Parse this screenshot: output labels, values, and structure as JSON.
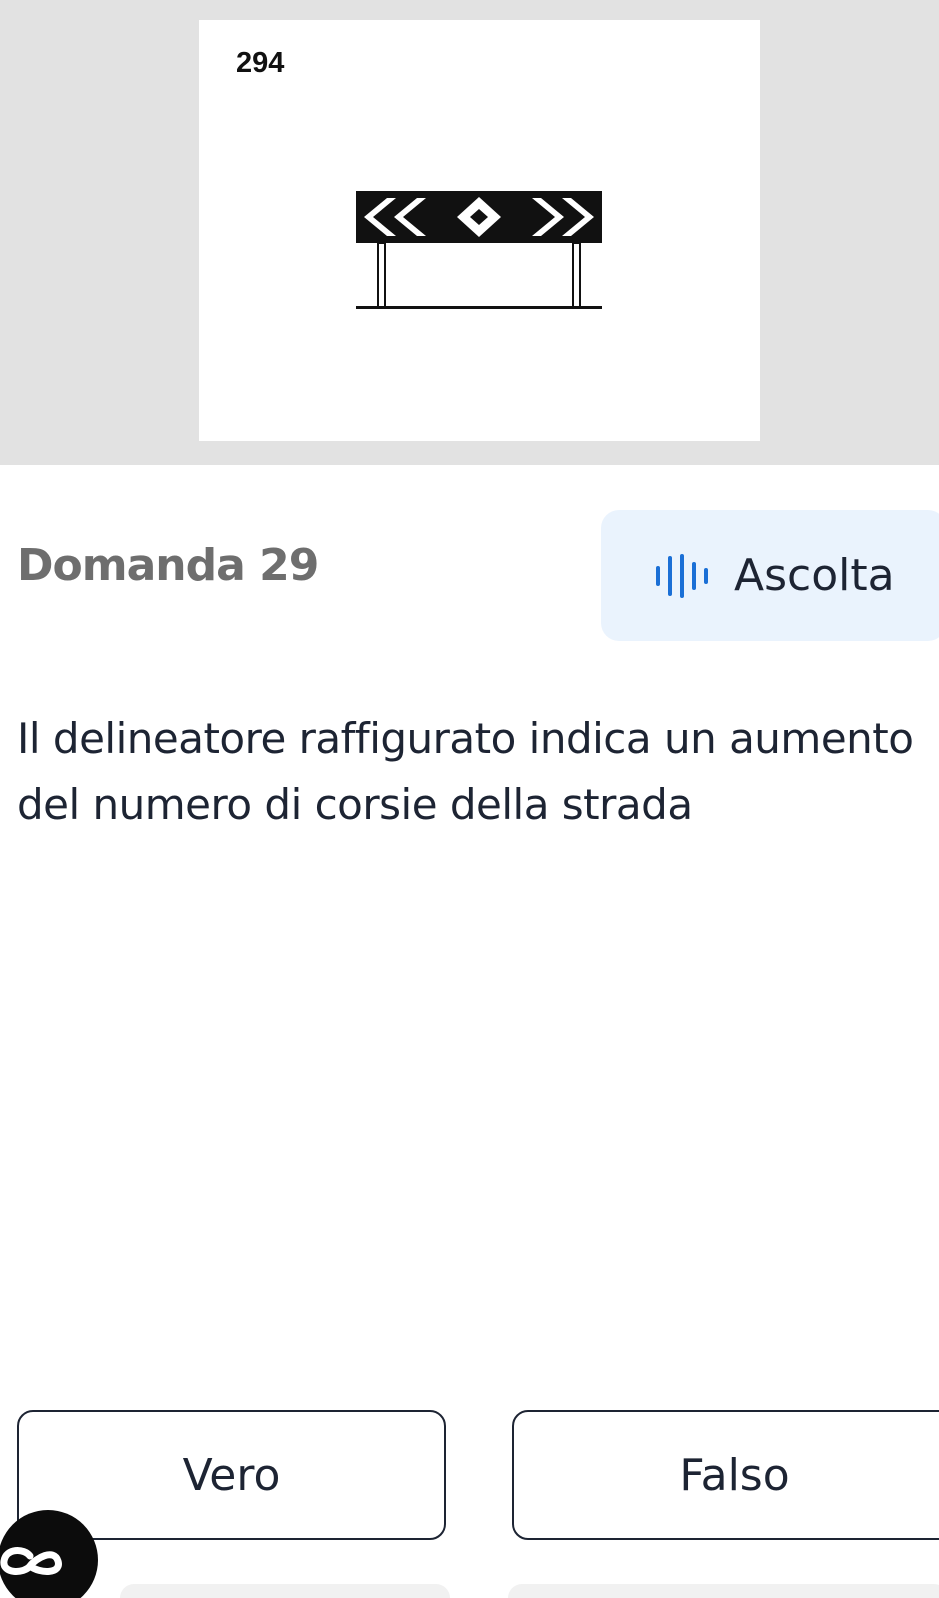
{
  "figure": {
    "number": "294",
    "icon": "chevron-barrier-sign-icon"
  },
  "question": {
    "header": "Domanda 29",
    "text": "Il delineatore raffigurato indica un aumento del numero di corsie della strada"
  },
  "listen_button": {
    "icon": "sound-wave-icon",
    "label": "Ascolta"
  },
  "answers": {
    "true_label": "Vero",
    "false_label": "Falso"
  },
  "badge": {
    "icon": "infinity-logo-icon"
  },
  "colors": {
    "image_background": "#e2e2e2",
    "listen_background": "#eaf3fd",
    "wave_blue": "#1a6fd6",
    "text_dark": "#1d2433",
    "header_gray": "#6e6e6e"
  }
}
